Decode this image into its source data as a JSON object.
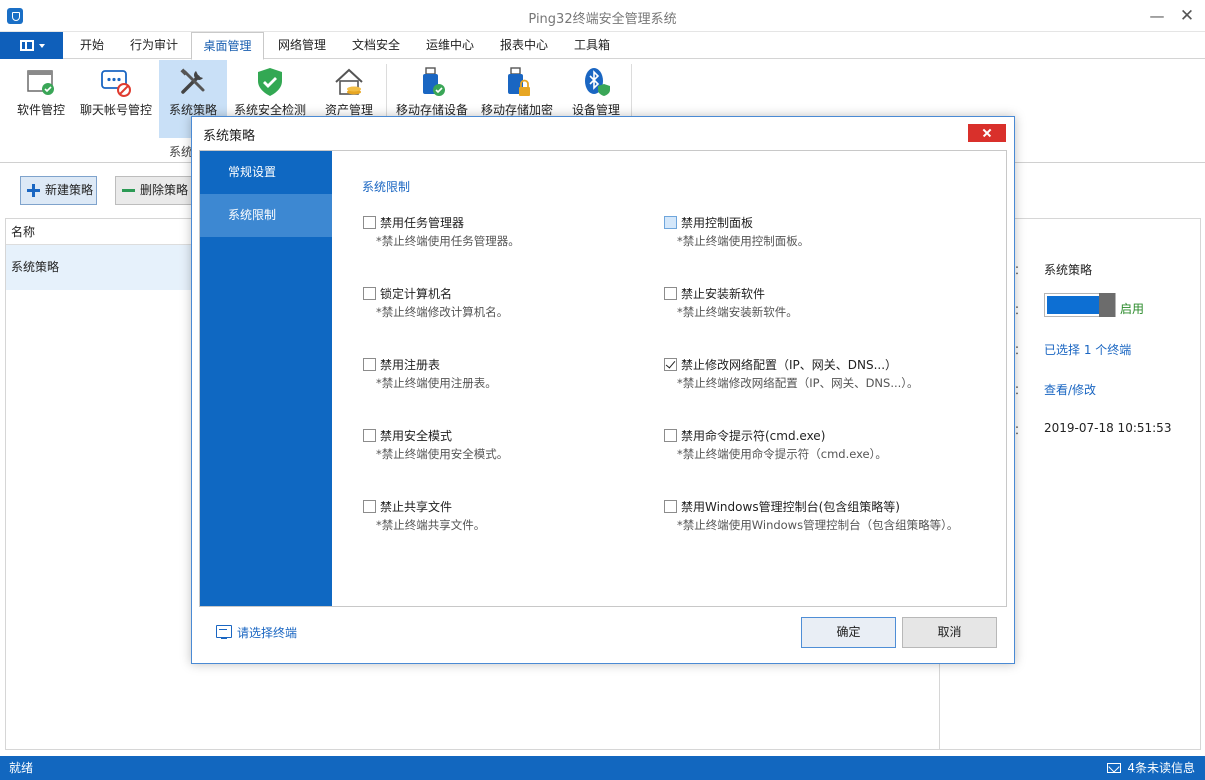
{
  "window": {
    "title": "Ping32终端安全管理系统"
  },
  "menu": {
    "tabs": [
      "开始",
      "行为审计",
      "桌面管理",
      "网络管理",
      "文档安全",
      "运维中心",
      "报表中心",
      "工具箱"
    ],
    "active_index": 2
  },
  "ribbon": {
    "items": [
      "软件管控",
      "聊天帐号管控",
      "系统策略",
      "系统安全检测",
      "资产管理",
      "移动存储设备",
      "移动存储加密",
      "设备管理"
    ],
    "group_label": "系统"
  },
  "toolbar": {
    "add_label": "新建策略",
    "delete_label": "删除策略"
  },
  "list": {
    "header": "名称",
    "rows": [
      "系统策略"
    ]
  },
  "detail": {
    "name_value": "系统策略",
    "status_label": "启用",
    "status_enabled": true,
    "terminals_link": "已选择 1 个终端",
    "view_link": "查看/修改",
    "time_value": "2019-07-18 10:51:53",
    "colon": "："
  },
  "status_bar": {
    "left": "就绪",
    "right": "4条未读信息"
  },
  "dialog": {
    "title": "系统策略",
    "nav": [
      "常规设置",
      "系统限制"
    ],
    "nav_active": 1,
    "section_title": "系统限制",
    "options": [
      {
        "title": "禁用任务管理器",
        "desc": "*禁止终端使用任务管理器。",
        "checked": false
      },
      {
        "title": "禁用控制面板",
        "desc": "*禁止终端使用控制面板。",
        "checked": false,
        "hover": true
      },
      {
        "title": "锁定计算机名",
        "desc": "*禁止终端修改计算机名。",
        "checked": false
      },
      {
        "title": "禁止安装新软件",
        "desc": "*禁止终端安装新软件。",
        "checked": false
      },
      {
        "title": "禁用注册表",
        "desc": "*禁止终端使用注册表。",
        "checked": false
      },
      {
        "title": "禁止修改网络配置（IP、网关、DNS...）",
        "desc": "*禁止终端修改网络配置（IP、网关、DNS...）。",
        "checked": true
      },
      {
        "title": "禁用安全模式",
        "desc": "*禁止终端使用安全模式。",
        "checked": false
      },
      {
        "title": "禁用命令提示符(cmd.exe)",
        "desc": "*禁止终端使用命令提示符（cmd.exe）。",
        "checked": false
      },
      {
        "title": "禁止共享文件",
        "desc": "*禁止终端共享文件。",
        "checked": false
      },
      {
        "title": "禁用Windows管理控制台(包含组策略等)",
        "desc": "*禁止终端使用Windows管理控制台（包含组策略等）。",
        "checked": false
      }
    ],
    "select_terminal_link": "请选择终端",
    "ok_label": "确定",
    "cancel_label": "取消"
  },
  "colors": {
    "accent": "#0f68c2",
    "close": "#d9302b"
  }
}
